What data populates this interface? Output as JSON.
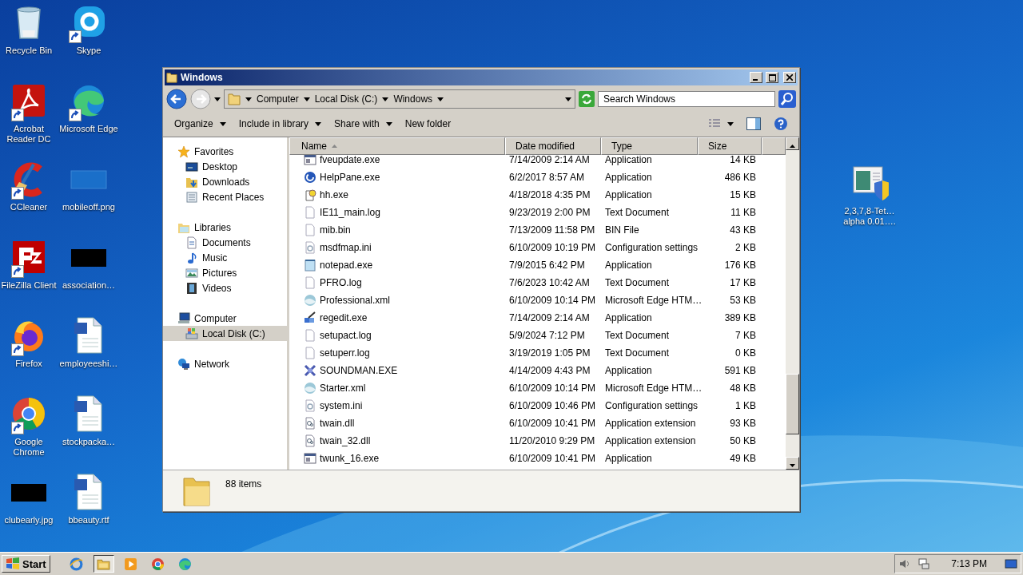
{
  "desktop_icons": [
    {
      "label": "Recycle Bin",
      "kind": "bin",
      "shortcut": false
    },
    {
      "label": "Skype",
      "kind": "chat",
      "shortcut": true
    },
    {
      "label": "Acrobat Reader DC",
      "kind": "pdf",
      "shortcut": true
    },
    {
      "label": "Microsoft Edge",
      "kind": "edge",
      "shortcut": true
    },
    {
      "label": "CCleaner",
      "kind": "cleaner",
      "shortcut": true
    },
    {
      "label": "mobileoff.png",
      "kind": "image-blue",
      "shortcut": false
    },
    {
      "label": "FileZilla Client",
      "kind": "ftp",
      "shortcut": true
    },
    {
      "label": "association…",
      "kind": "image-black",
      "shortcut": false
    },
    {
      "label": "Firefox",
      "kind": "firefox",
      "shortcut": true
    },
    {
      "label": "employeeshi…",
      "kind": "word",
      "shortcut": false
    },
    {
      "label": "Google Chrome",
      "kind": "chrome",
      "shortcut": true
    },
    {
      "label": "stockpacka…",
      "kind": "word",
      "shortcut": false
    },
    {
      "label": "clubearly.jpg",
      "kind": "image-black",
      "shortcut": false
    },
    {
      "label": "bbeauty.rtf",
      "kind": "word",
      "shortcut": false
    }
  ],
  "right_icon": {
    "label": "2,3,7,8-Tet… alpha 0.01….",
    "kind": "installer"
  },
  "window": {
    "title": "Windows",
    "breadcrumbs": [
      "Computer",
      "Local Disk (C:)",
      "Windows"
    ],
    "search": {
      "placeholder": "Search Windows"
    },
    "toolbar": [
      {
        "label": "Organize",
        "dropdown": true
      },
      {
        "label": "Include in library",
        "dropdown": true
      },
      {
        "label": "Share with",
        "dropdown": true
      },
      {
        "label": "New folder",
        "dropdown": false
      }
    ],
    "sidebar": [
      {
        "label": "Favorites",
        "kind": "star",
        "selected": false,
        "children": [
          {
            "label": "Desktop",
            "kind": "desktop",
            "selected": false
          },
          {
            "label": "Downloads",
            "kind": "downloads",
            "selected": false
          },
          {
            "label": "Recent Places",
            "kind": "recent",
            "selected": false
          }
        ]
      },
      {
        "label": "Libraries",
        "kind": "library",
        "selected": false,
        "children": [
          {
            "label": "Documents",
            "kind": "documents",
            "selected": false
          },
          {
            "label": "Music",
            "kind": "music",
            "selected": false
          },
          {
            "label": "Pictures",
            "kind": "pictures",
            "selected": false
          },
          {
            "label": "Videos",
            "kind": "videos",
            "selected": false
          }
        ]
      },
      {
        "label": "Computer",
        "kind": "computer",
        "selected": false,
        "children": [
          {
            "label": "Local Disk (C:)",
            "kind": "disk",
            "selected": true
          }
        ]
      },
      {
        "label": "Network",
        "kind": "network",
        "selected": false
      }
    ],
    "table": {
      "columns": [
        "Name",
        "Date modified",
        "Type",
        "Size"
      ],
      "rows": [
        {
          "name": "fveupdate.exe",
          "date": "7/14/2009 2:14 AM",
          "type": "Application",
          "size": "14 KB",
          "kind": "exe"
        },
        {
          "name": "HelpPane.exe",
          "date": "6/2/2017 8:57 AM",
          "type": "Application",
          "size": "486 KB",
          "kind": "help"
        },
        {
          "name": "hh.exe",
          "date": "4/18/2018 4:35 PM",
          "type": "Application",
          "size": "15 KB",
          "kind": "hh"
        },
        {
          "name": "IE11_main.log",
          "date": "9/23/2019 2:00 PM",
          "type": "Text Document",
          "size": "11 KB",
          "kind": "text"
        },
        {
          "name": "mib.bin",
          "date": "7/13/2009 11:58 PM",
          "type": "BIN File",
          "size": "43 KB",
          "kind": "text"
        },
        {
          "name": "msdfmap.ini",
          "date": "6/10/2009 10:19 PM",
          "type": "Configuration settings",
          "size": "2 KB",
          "kind": "ini"
        },
        {
          "name": "notepad.exe",
          "date": "7/9/2015 6:42 PM",
          "type": "Application",
          "size": "176 KB",
          "kind": "notepad"
        },
        {
          "name": "PFRO.log",
          "date": "7/6/2023 10:42 AM",
          "type": "Text Document",
          "size": "17 KB",
          "kind": "text"
        },
        {
          "name": "Professional.xml",
          "date": "6/10/2009 10:14 PM",
          "type": "Microsoft Edge HTM…",
          "size": "53 KB",
          "kind": "web"
        },
        {
          "name": "regedit.exe",
          "date": "7/14/2009 2:14 AM",
          "type": "Application",
          "size": "389 KB",
          "kind": "regedit"
        },
        {
          "name": "setupact.log",
          "date": "5/9/2024 7:12 PM",
          "type": "Text Document",
          "size": "7 KB",
          "kind": "text"
        },
        {
          "name": "setuperr.log",
          "date": "3/19/2019 1:05 PM",
          "type": "Text Document",
          "size": "0 KB",
          "kind": "text"
        },
        {
          "name": "SOUNDMAN.EXE",
          "date": "4/14/2009 4:43 PM",
          "type": "Application",
          "size": "591 KB",
          "kind": "sound"
        },
        {
          "name": "Starter.xml",
          "date": "6/10/2009 10:14 PM",
          "type": "Microsoft Edge HTM…",
          "size": "48 KB",
          "kind": "web"
        },
        {
          "name": "system.ini",
          "date": "6/10/2009 10:46 PM",
          "type": "Configuration settings",
          "size": "1 KB",
          "kind": "ini"
        },
        {
          "name": "twain.dll",
          "date": "6/10/2009 10:41 PM",
          "type": "Application extension",
          "size": "93 KB",
          "kind": "dll"
        },
        {
          "name": "twain_32.dll",
          "date": "11/20/2010 9:29 PM",
          "type": "Application extension",
          "size": "50 KB",
          "kind": "dll"
        },
        {
          "name": "twunk_16.exe",
          "date": "6/10/2009 10:41 PM",
          "type": "Application",
          "size": "49 KB",
          "kind": "exe"
        }
      ]
    },
    "details": {
      "count": "88 items"
    }
  },
  "taskbar": {
    "start": "Start",
    "apps": [
      {
        "kind": "ie",
        "selected": false
      },
      {
        "kind": "explorer",
        "selected": true
      },
      {
        "kind": "media",
        "selected": false
      },
      {
        "kind": "chrome",
        "selected": false
      },
      {
        "kind": "edge",
        "selected": false
      }
    ],
    "clock": "7:13 PM"
  }
}
